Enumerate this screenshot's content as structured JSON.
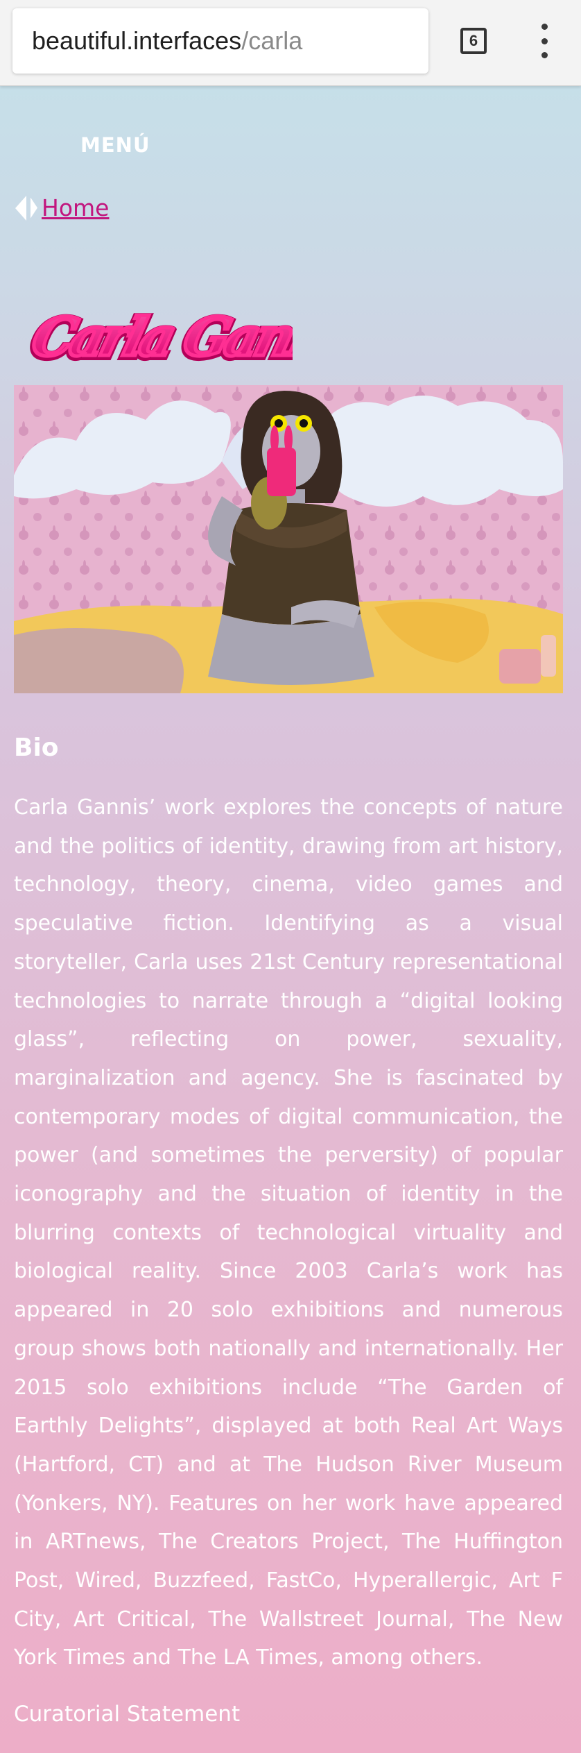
{
  "browser": {
    "url_host": "beautiful.interfaces",
    "url_path": "/carla",
    "tab_count": "6",
    "menu_icon": "kebab-menu-icon"
  },
  "nav": {
    "menu_label": "MENÚ",
    "home_label": "Home",
    "back_icon": "back-arrow-icon"
  },
  "logo": {
    "text": "Carla Gannis",
    "color": "#e8177f"
  },
  "hero": {
    "image": "artist-selfie-artwork"
  },
  "bio": {
    "heading": "Bio",
    "text": "Carla Gannis’ work explores the concepts of nature and the politics of identity, drawing from art history, technology, theory, cinema, video games and speculative fiction. Identifying as a visual storyteller, Carla uses 21st Century representational technologies to narrate through a “digital looking glass”, reflecting on power, sexuality, marginalization and agency. She is fascinated by contemporary modes of digital communication, the power (and sometimes the perversity) of popular iconography and the situation of identity in the blurring contexts of technological virtuality and biological reality. Since 2003 Carla’s work has appeared in 20 solo exhibitions and numerous group shows both nationally and internationally. Her 2015 solo exhibitions include “The Garden of Earthly Delights”, displayed at both Real Art Ways (Hartford, CT) and at The Hudson River Museum (Yonkers, NY). Features on her work have appeared in ARTnews, The Creators Project, The Huffington Post, Wired, Buzzfeed, FastCo, Hyperallergic, Art F City, Art Critical, The Wallstreet Journal, The New York Times and The LA Times, among others."
  },
  "curatorial": {
    "label": "Curatorial Statement"
  },
  "colors": {
    "link": "#c2157e",
    "accent": "#e8177f",
    "text": "#ffffff"
  }
}
